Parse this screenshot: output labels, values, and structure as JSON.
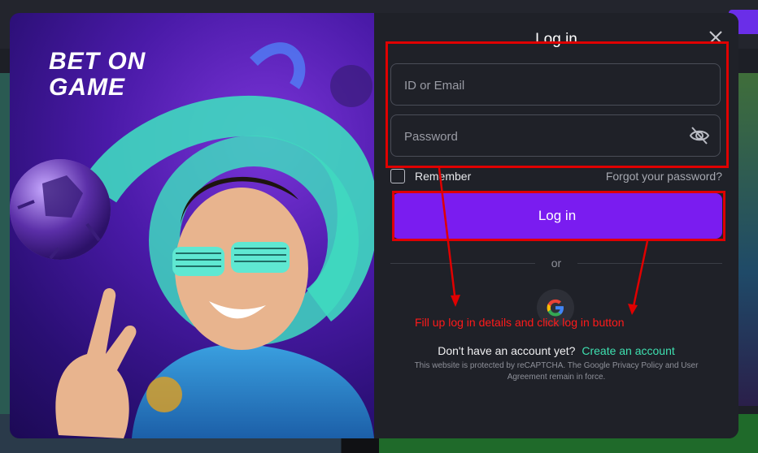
{
  "modal": {
    "logo_line1": "BET ON",
    "logo_line2": "GAME",
    "title": "Log in",
    "id_placeholder": "ID or Email",
    "password_placeholder": "Password",
    "remember_label": "Remember",
    "forgot_label": "Forgot your password?",
    "login_button": "Log in",
    "or_text": "or",
    "annotation": "Fill up log in details and click log in button",
    "signup_prompt": "Don't have an account yet?",
    "signup_link": "Create an account",
    "recaptcha_text": "This website is protected by reCAPTCHA. The Google Privacy Policy and User Agreement remain in force."
  },
  "colors": {
    "accent": "#7a1cf0",
    "link": "#3ee0b0",
    "annotation": "#ff1a1a"
  },
  "icons": [
    "close-icon",
    "eye-off-icon",
    "google-icon",
    "checkbox-icon"
  ]
}
